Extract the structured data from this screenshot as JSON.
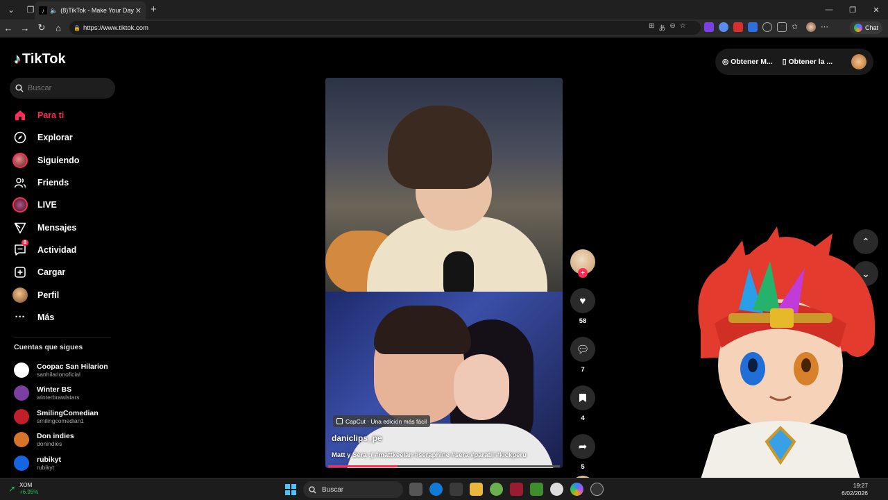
{
  "browser": {
    "tab_title": "(8)TikTok - Make Your Day",
    "url": "https://www.tiktok.com",
    "chat_label": "Chat"
  },
  "brand": {
    "name": "TikTok",
    "accent": "#fe2c55"
  },
  "search": {
    "placeholder": "Buscar"
  },
  "menu": [
    {
      "label": "Para ti",
      "icon": "home-icon",
      "active": true
    },
    {
      "label": "Explorar",
      "icon": "compass-icon"
    },
    {
      "label": "Siguiendo",
      "icon": "following-avatar-icon"
    },
    {
      "label": "Friends",
      "icon": "friends-icon"
    },
    {
      "label": "LIVE",
      "icon": "live-avatar-icon"
    },
    {
      "label": "Mensajes",
      "icon": "send-icon"
    },
    {
      "label": "Actividad",
      "icon": "activity-icon",
      "badge": "8"
    },
    {
      "label": "Cargar",
      "icon": "upload-icon"
    },
    {
      "label": "Perfil",
      "icon": "profile-avatar-icon"
    },
    {
      "label": "Más",
      "icon": "more-icon"
    }
  ],
  "following_title": "Cuentas que sigues",
  "following": [
    {
      "name": "Coopac San Hilarion",
      "handle": "sanhilarionoficial",
      "color": "#ffffff"
    },
    {
      "name": "Winter BS",
      "handle": "winterbrawlstars",
      "color": "#7a3fa0"
    },
    {
      "name": "SmilingComedian",
      "handle": "smilingcomedian1",
      "color": "#c0202a"
    },
    {
      "name": "Don indies",
      "handle": "donindies",
      "color": "#d8742a"
    },
    {
      "name": "rubikyt",
      "handle": "rubikyt",
      "color": "#1565e0"
    }
  ],
  "top_buttons": {
    "get_coins": "Obtener M...",
    "get_app": "Obtener la ..."
  },
  "video": {
    "capcut": "CapCut · Una edición más fácil",
    "author": "daniclips_pe",
    "description": "Matt y Sera :( #mattkeelan #seraphine #sera #paratii #kickperu",
    "progress": 0.3
  },
  "actions": {
    "likes": "58",
    "comments": "7",
    "saves": "4",
    "shares": "5"
  },
  "taskbar": {
    "stock_symbol": "XOM",
    "stock_change": "+6.95%",
    "search_label": "Buscar",
    "time": "19:27",
    "date": "6/02/2026"
  }
}
